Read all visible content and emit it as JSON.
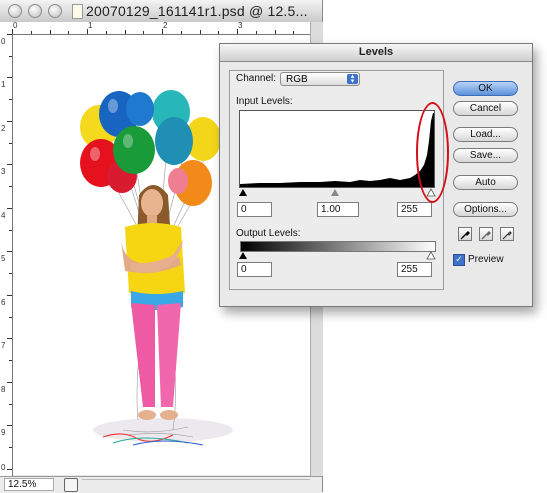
{
  "document": {
    "title": "20070129_161141r1.psd @ 12.5...",
    "zoom": "12.5%",
    "ruler_top_numbers": [
      "0",
      "1",
      "2",
      "3"
    ],
    "ruler_left_numbers": [
      "0",
      "1",
      "2",
      "3",
      "4",
      "5",
      "6",
      "7",
      "8",
      "9",
      "0"
    ]
  },
  "levels_dialog": {
    "title": "Levels",
    "channel_label": "Channel:",
    "channel_value": "RGB",
    "input_levels_label": "Input Levels:",
    "input_black": "0",
    "input_gamma": "1.00",
    "input_white": "255",
    "output_levels_label": "Output Levels:",
    "output_black": "0",
    "output_white": "255",
    "buttons": {
      "ok": "OK",
      "cancel": "Cancel",
      "load": "Load...",
      "save": "Save...",
      "auto": "Auto",
      "options": "Options..."
    },
    "preview_label": "Preview",
    "preview_checked": true,
    "eyedroppers": [
      "black-eyedropper-icon",
      "gray-eyedropper-icon",
      "white-eyedropper-icon"
    ]
  },
  "annotation_color": "#d31018",
  "accent_color": "#3c72c9"
}
